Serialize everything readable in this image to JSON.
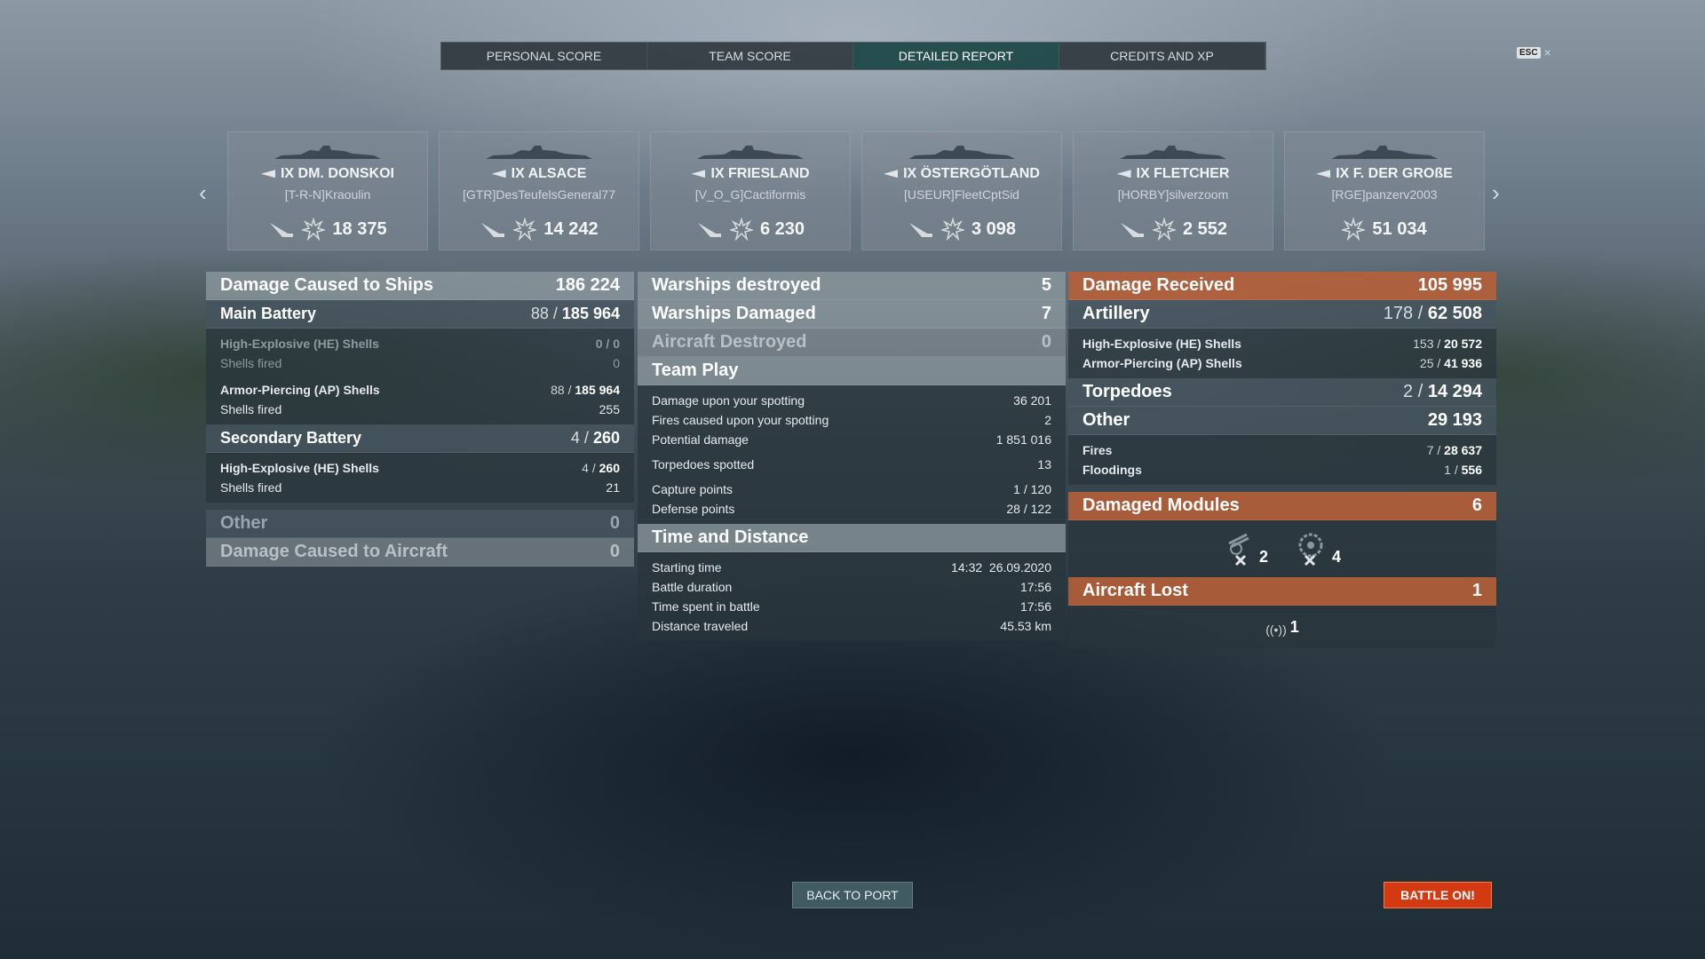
{
  "tabs": [
    {
      "label": "PERSONAL SCORE"
    },
    {
      "label": "TEAM SCORE"
    },
    {
      "label": "DETAILED REPORT",
      "active": true
    },
    {
      "label": "CREDITS AND XP"
    }
  ],
  "esc": {
    "key": "ESC",
    "close": "×"
  },
  "ships": [
    {
      "name": "IX DM. DONSKOI",
      "player": "[T-R-N]Kraoulin",
      "value": "18 375"
    },
    {
      "name": "IX ALSACE",
      "player": "[GTR]DesTeufelsGeneral77",
      "value": "14 242"
    },
    {
      "name": "IX FRIESLAND",
      "player": "[V_O_G]Cactiformis",
      "value": "6 230"
    },
    {
      "name": "IX ÖSTERGÖTLAND",
      "player": "[USEUR]FleetCptSid",
      "value": "3 098"
    },
    {
      "name": "IX FLETCHER",
      "player": "[HORBY]silverzoom",
      "value": "2 552"
    },
    {
      "name": "IX F. DER GROßE",
      "player": "[RGE]panzerv2003",
      "value": "51 034"
    }
  ],
  "left": {
    "damage_ships": {
      "label": "Damage Caused to Ships",
      "value": "186 224"
    },
    "main_battery": {
      "label": "Main Battery",
      "hits": "88",
      "sep": "/",
      "dmg": "185 964"
    },
    "he_shells": {
      "label": "High-Explosive (HE) Shells",
      "value": "0 / 0"
    },
    "he_fired": {
      "label": "Shells fired",
      "value": "0"
    },
    "ap_shells": {
      "label": "Armor-Piercing (AP) Shells",
      "hits": "88",
      "sep": "/",
      "dmg": "185 964"
    },
    "ap_fired": {
      "label": "Shells fired",
      "value": "255"
    },
    "secondary": {
      "label": "Secondary Battery",
      "hits": "4",
      "sep": "/",
      "dmg": "260"
    },
    "sec_he": {
      "label": "High-Explosive (HE) Shells",
      "hits": "4",
      "sep": "/",
      "dmg": "260"
    },
    "sec_fired": {
      "label": "Shells fired",
      "value": "21"
    },
    "other": {
      "label": "Other",
      "value": "0"
    },
    "aircraft": {
      "label": "Damage Caused to Aircraft",
      "value": "0"
    }
  },
  "middle": {
    "destroyed": {
      "label": "Warships destroyed",
      "value": "5"
    },
    "damaged": {
      "label": "Warships Damaged",
      "value": "7"
    },
    "aircraft_destroyed": {
      "label": "Aircraft Destroyed",
      "value": "0"
    },
    "team_play": {
      "label": "Team Play"
    },
    "spotting_damage": {
      "label": "Damage upon your spotting",
      "value": "36 201"
    },
    "spotting_fires": {
      "label": "Fires caused upon your spotting",
      "value": "2"
    },
    "potential": {
      "label": "Potential damage",
      "value": "1 851 016"
    },
    "torps_spotted": {
      "label": "Torpedoes spotted",
      "value": "13"
    },
    "capture": {
      "label": "Capture points",
      "value": "1 / 120"
    },
    "defense": {
      "label": "Defense points",
      "value": "28 / 122"
    },
    "time_distance": {
      "label": "Time and Distance"
    },
    "start": {
      "label": "Starting time",
      "value": "14:32  26.09.2020"
    },
    "duration": {
      "label": "Battle duration",
      "value": "17:56"
    },
    "in_battle": {
      "label": "Time spent in battle",
      "value": "17:56"
    },
    "distance": {
      "label": "Distance traveled",
      "value": "45.53 km"
    }
  },
  "right": {
    "received": {
      "label": "Damage Received",
      "value": "105 995"
    },
    "artillery": {
      "label": "Artillery",
      "hits": "178",
      "sep": "/",
      "dmg": "62 508"
    },
    "he": {
      "label": "High-Explosive (HE) Shells",
      "hits": "153",
      "sep": "/",
      "dmg": "20 572"
    },
    "ap": {
      "label": "Armor-Piercing (AP) Shells",
      "hits": "25",
      "sep": "/",
      "dmg": "41 936"
    },
    "torpedoes": {
      "label": "Torpedoes",
      "hits": "2",
      "sep": "/",
      "dmg": "14 294"
    },
    "other": {
      "label": "Other",
      "value": "29 193"
    },
    "fires": {
      "label": "Fires",
      "hits": "7",
      "sep": "/",
      "dmg": "28 637"
    },
    "floodings": {
      "label": "Floodings",
      "hits": "1",
      "sep": "/",
      "dmg": "556"
    },
    "modules": {
      "label": "Damaged Modules",
      "value": "6",
      "items": [
        {
          "icon": "gun-module-icon",
          "count": "2"
        },
        {
          "icon": "engine-module-icon",
          "count": "4"
        }
      ]
    },
    "aircraft_lost": {
      "label": "Aircraft Lost",
      "value": "1",
      "count": "1"
    }
  },
  "buttons": {
    "port": "BACK TO PORT",
    "battle": "BATTLE ON!"
  },
  "colors": {
    "accent_orange": "#b86038",
    "battle_button": "#d33a12",
    "active_tab": "#235050"
  }
}
